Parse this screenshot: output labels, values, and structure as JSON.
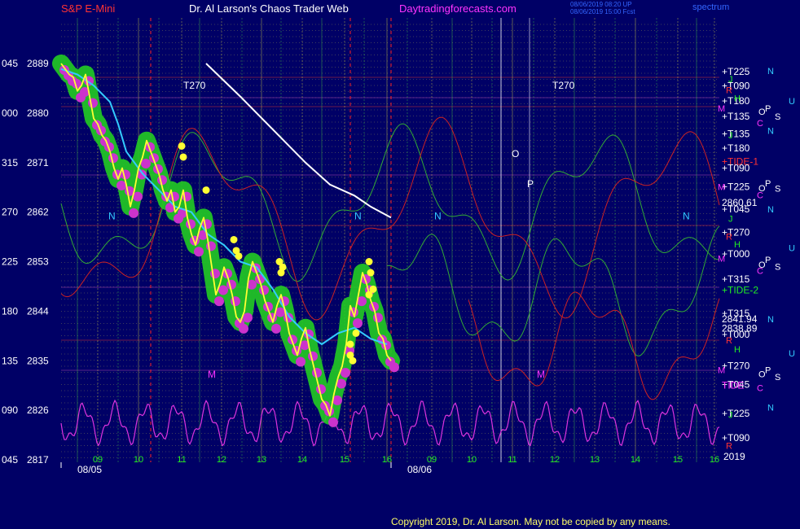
{
  "header": {
    "instrument": "S&P E-Mini",
    "site": "Dr. Al Larson's Chaos Trader Web",
    "link": "Daytradingforecasts.com",
    "timestamp1": "08/06/2019 08:20 UP",
    "timestamp2": "08/06/2019 15:00 Fcst",
    "corner": "spectrum"
  },
  "footer": {
    "copyright": "Copyright 2019, Dr. Al Larson. May not be copied by any means."
  },
  "colors": {
    "background": "#000066",
    "price": "#ffff33",
    "price_band": "#22cc22",
    "cyan_average": "#33ccff",
    "white_trend": "#ffffff",
    "magenta_dots": "#cc33cc",
    "electrical_red": "#ff2222",
    "gridline": "#dddd44"
  },
  "chart_data": {
    "type": "line",
    "title": "S&P E-Mini",
    "ylim": [
      2817,
      2889
    ],
    "xlim": [
      0,
      808
    ],
    "y_ticks": [
      {
        "price": 2889,
        "angle": "045"
      },
      {
        "price": 2880,
        "angle": "000"
      },
      {
        "price": 2871,
        "angle": "315"
      },
      {
        "price": 2862,
        "angle": "270"
      },
      {
        "price": 2853,
        "angle": "225"
      },
      {
        "price": 2844,
        "angle": "180"
      },
      {
        "price": 2835,
        "angle": "135"
      },
      {
        "price": 2826,
        "angle": "090"
      },
      {
        "price": 2817,
        "angle": "045"
      }
    ],
    "x_ticks": [
      {
        "x": 45,
        "label": "09"
      },
      {
        "x": 95,
        "label": "10"
      },
      {
        "x": 148,
        "label": "11"
      },
      {
        "x": 197,
        "label": "12"
      },
      {
        "x": 246,
        "label": "13"
      },
      {
        "x": 296,
        "label": "14"
      },
      {
        "x": 348,
        "label": "15"
      },
      {
        "x": 400,
        "label": "16"
      },
      {
        "x": 455,
        "label": "09"
      },
      {
        "x": 504,
        "label": "10"
      },
      {
        "x": 554,
        "label": "11"
      },
      {
        "x": 606,
        "label": "12"
      },
      {
        "x": 655,
        "label": "13"
      },
      {
        "x": 705,
        "label": "14"
      },
      {
        "x": 757,
        "label": "15"
      },
      {
        "x": 802,
        "label": "16"
      }
    ],
    "date_labels": [
      {
        "x": 20,
        "label": "08/05"
      },
      {
        "x": 425,
        "label": "08/06"
      }
    ],
    "year_label": "2019",
    "right_labels": [
      {
        "price": 2887.5,
        "text": "+T225",
        "color": "#ffffff"
      },
      {
        "price": 2884.9,
        "text": "+T090",
        "color": "#ffffff"
      },
      {
        "price": 2882.2,
        "text": "+T180",
        "color": "#ffffff"
      },
      {
        "price": 2879.4,
        "text": "+T135",
        "color": "#ffffff"
      },
      {
        "price": 2876.2,
        "text": "+T135",
        "color": "#ffffff"
      },
      {
        "price": 2873.6,
        "text": "+T180",
        "color": "#ffffff"
      },
      {
        "price": 2871.2,
        "text": "+TIDE-1",
        "color": "#ff3333"
      },
      {
        "price": 2870.0,
        "text": "+T090",
        "color": "#ffffff"
      },
      {
        "price": 2866.6,
        "text": "+T225",
        "color": "#ffffff"
      },
      {
        "price": 2863.7,
        "text": "2860.61",
        "color": "#ffffff"
      },
      {
        "price": 2862.5,
        "text": "+T045",
        "color": "#ffffff"
      },
      {
        "price": 2858.3,
        "text": "+T270",
        "color": "#ffffff"
      },
      {
        "price": 2854.4,
        "text": "+T000",
        "color": "#ffffff"
      },
      {
        "price": 2849.8,
        "text": "+T315",
        "color": "#ffffff"
      },
      {
        "price": 2847.8,
        "text": "+TIDE-2",
        "color": "#22ee22"
      },
      {
        "price": 2843.6,
        "text": "+T315",
        "color": "#ffffff"
      },
      {
        "price": 2842.6,
        "text": "2841.94",
        "color": "#ffffff"
      },
      {
        "price": 2840.9,
        "text": "2838.89",
        "color": "#ffffff"
      },
      {
        "price": 2839.8,
        "text": "+T000",
        "color": "#ffffff"
      },
      {
        "price": 2834.1,
        "text": "+T270",
        "color": "#ffffff"
      },
      {
        "price": 2830.7,
        "text": "+T045",
        "color": "#ffffff"
      },
      {
        "price": 2830.5,
        "text": "TIDE",
        "color": "#ff33ff"
      },
      {
        "price": 2825.4,
        "text": "+T225",
        "color": "#ffffff"
      },
      {
        "price": 2821.0,
        "text": "+T090",
        "color": "#ffffff"
      }
    ],
    "planet_markers": [
      {
        "x": 867,
        "price": 2887.7,
        "text": "N",
        "color": "#33ccff"
      },
      {
        "x": 819,
        "price": 2886.2,
        "text": "J",
        "color": "#22ee22"
      },
      {
        "x": 816,
        "price": 2884.2,
        "text": "R",
        "color": "#ff3333"
      },
      {
        "x": 826,
        "price": 2882.7,
        "text": "H",
        "color": "#22ee22"
      },
      {
        "x": 893,
        "price": 2882.2,
        "text": "U",
        "color": "#33ccff"
      },
      {
        "x": 806,
        "price": 2880.9,
        "text": "M",
        "color": "#ff33ff"
      },
      {
        "x": 856,
        "price": 2880.3,
        "text": "O",
        "color": "#ffffff"
      },
      {
        "x": 864,
        "price": 2880.9,
        "text": "P",
        "color": "#ffffff"
      },
      {
        "x": 876,
        "price": 2879.4,
        "text": "S",
        "color": "#ffffff"
      },
      {
        "x": 854,
        "price": 2878.2,
        "text": "C",
        "color": "#ff33ff"
      },
      {
        "x": 867,
        "price": 2876.8,
        "text": "N",
        "color": "#33ccff"
      },
      {
        "x": 819,
        "price": 2876.0,
        "text": "J",
        "color": "#22ee22"
      },
      {
        "x": 806,
        "price": 2866.6,
        "text": "M",
        "color": "#ff33ff"
      },
      {
        "x": 856,
        "price": 2866.4,
        "text": "O",
        "color": "#ffffff"
      },
      {
        "x": 864,
        "price": 2867.3,
        "text": "P",
        "color": "#ffffff"
      },
      {
        "x": 876,
        "price": 2866.3,
        "text": "S",
        "color": "#ffffff"
      },
      {
        "x": 854,
        "price": 2865.1,
        "text": "C",
        "color": "#ff33ff"
      },
      {
        "x": 867,
        "price": 2862.5,
        "text": "N",
        "color": "#33ccff"
      },
      {
        "x": 819,
        "price": 2860.8,
        "text": "J",
        "color": "#22ee22"
      },
      {
        "x": 816,
        "price": 2857.6,
        "text": "R",
        "color": "#ff3333"
      },
      {
        "x": 826,
        "price": 2856.2,
        "text": "H",
        "color": "#22ee22"
      },
      {
        "x": 893,
        "price": 2855.5,
        "text": "U",
        "color": "#33ccff"
      },
      {
        "x": 806,
        "price": 2853.6,
        "text": "M",
        "color": "#ff33ff"
      },
      {
        "x": 856,
        "price": 2852.5,
        "text": "O",
        "color": "#ffffff"
      },
      {
        "x": 864,
        "price": 2853.4,
        "text": "P",
        "color": "#ffffff"
      },
      {
        "x": 876,
        "price": 2852.1,
        "text": "S",
        "color": "#ffffff"
      },
      {
        "x": 854,
        "price": 2851.4,
        "text": "C",
        "color": "#ff33ff"
      },
      {
        "x": 867,
        "price": 2842.6,
        "text": "N",
        "color": "#33ccff"
      },
      {
        "x": 816,
        "price": 2838.7,
        "text": "R",
        "color": "#ff3333"
      },
      {
        "x": 826,
        "price": 2837.1,
        "text": "H",
        "color": "#22ee22"
      },
      {
        "x": 893,
        "price": 2836.4,
        "text": "U",
        "color": "#33ccff"
      },
      {
        "x": 806,
        "price": 2833.3,
        "text": "M",
        "color": "#ff33ff"
      },
      {
        "x": 856,
        "price": 2832.6,
        "text": "O",
        "color": "#ffffff"
      },
      {
        "x": 864,
        "price": 2833.3,
        "text": "P",
        "color": "#ffffff"
      },
      {
        "x": 876,
        "price": 2832.1,
        "text": "S",
        "color": "#ffffff"
      },
      {
        "x": 854,
        "price": 2830.1,
        "text": "C",
        "color": "#ff33ff"
      },
      {
        "x": 867,
        "price": 2826.5,
        "text": "N",
        "color": "#33ccff"
      },
      {
        "x": 819,
        "price": 2825.2,
        "text": "J",
        "color": "#22ee22"
      },
      {
        "x": 816,
        "price": 2819.6,
        "text": "R",
        "color": "#ff3333"
      }
    ],
    "chart_text": [
      {
        "x": 150,
        "price": 2885.0,
        "text": "T270",
        "color": "#ffffff"
      },
      {
        "x": 603,
        "price": 2885.0,
        "text": "T270",
        "color": "#ffffff"
      },
      {
        "x": 58,
        "price": 2861.3,
        "text": "N",
        "color": "#33ccff"
      },
      {
        "x": 360,
        "price": 2861.3,
        "text": "N",
        "color": "#33ccff"
      },
      {
        "x": 458,
        "price": 2861.3,
        "text": "N",
        "color": "#33ccff"
      },
      {
        "x": 763,
        "price": 2861.3,
        "text": "N",
        "color": "#33ccff"
      },
      {
        "x": 553,
        "price": 2872.6,
        "text": "O",
        "color": "#ffffff"
      },
      {
        "x": 572,
        "price": 2867.1,
        "text": "P",
        "color": "#ffffff"
      },
      {
        "x": 180,
        "price": 2832.5,
        "text": "M",
        "color": "#ff33ff"
      },
      {
        "x": 584,
        "price": 2832.5,
        "text": "M",
        "color": "#ff33ff"
      }
    ],
    "series": [
      {
        "name": "S&P E-Mini",
        "x": [
          0,
          5,
          10,
          15,
          20,
          25,
          30,
          35,
          40,
          45,
          50,
          55,
          60,
          65,
          70,
          75,
          80,
          85,
          90,
          95,
          100,
          105,
          110,
          115,
          120,
          125,
          130,
          135,
          140,
          145,
          150,
          155,
          160,
          165,
          170,
          175,
          180,
          185,
          190,
          195,
          200,
          205,
          210,
          215,
          220,
          225,
          230,
          235,
          240,
          245,
          250,
          255,
          260,
          265,
          270,
          275,
          280,
          285,
          290,
          295,
          300,
          305,
          310,
          315,
          320,
          325,
          330,
          335,
          340,
          345,
          350,
          355,
          360,
          365,
          370,
          375,
          380,
          385,
          390,
          395,
          400,
          405
        ],
        "y": [
          2889,
          2888,
          2887,
          2886.5,
          2884,
          2885,
          2887,
          2883,
          2879,
          2878,
          2876,
          2875,
          2873,
          2870,
          2868,
          2870,
          2867,
          2863,
          2866,
          2870,
          2872,
          2875,
          2873,
          2871,
          2869,
          2866,
          2864,
          2866,
          2862,
          2863,
          2866,
          2861,
          2858,
          2856,
          2859,
          2861,
          2857,
          2852,
          2847,
          2849,
          2852,
          2850,
          2847,
          2843,
          2842,
          2844,
          2850,
          2853,
          2851,
          2849,
          2846,
          2844,
          2842,
          2845,
          2847,
          2844,
          2840,
          2838,
          2836,
          2839,
          2841,
          2837,
          2834,
          2831,
          2828,
          2827,
          2825,
          2829,
          2832,
          2834,
          2838,
          2845,
          2843,
          2847,
          2851,
          2849,
          2846,
          2844,
          2840,
          2839,
          2836,
          2835
        ]
      },
      {
        "name": "cyan average",
        "x": [
          0,
          20,
          40,
          60,
          70,
          80,
          100,
          120,
          140,
          160,
          180,
          200,
          220,
          240,
          260,
          280,
          300,
          320,
          340,
          360,
          380,
          400
        ],
        "y": [
          2888,
          2887,
          2885,
          2882,
          2878,
          2873,
          2869,
          2866,
          2863,
          2862,
          2858,
          2856,
          2853,
          2852,
          2848,
          2843,
          2840,
          2838,
          2840,
          2841,
          2839,
          2838
        ]
      },
      {
        "name": "white trend",
        "x": [
          178,
          220,
          260,
          300,
          330,
          360,
          380,
          405
        ],
        "y": [
          2889,
          2883,
          2877,
          2871,
          2867,
          2865,
          2863,
          2861
        ]
      }
    ]
  }
}
